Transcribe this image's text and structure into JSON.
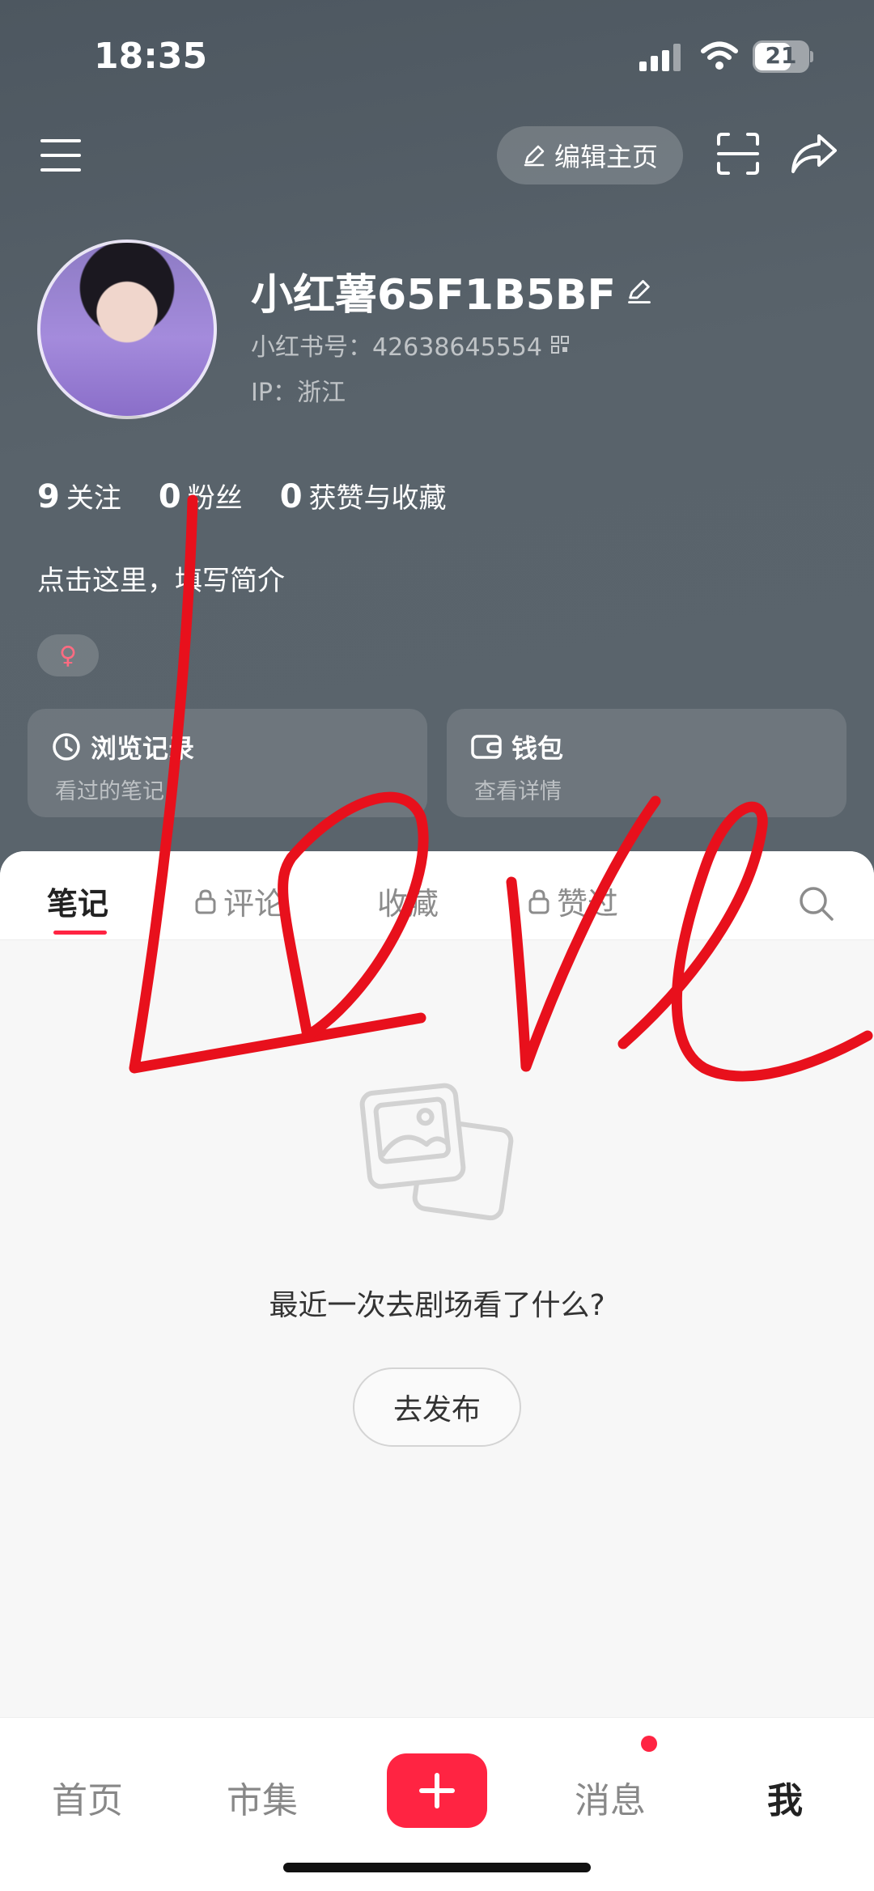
{
  "status_bar": {
    "time": "18:35",
    "battery": "21"
  },
  "header": {
    "edit_profile_label": "编辑主页"
  },
  "profile": {
    "nickname": "小红薯65F1B5BF",
    "red_id": "小红书号：42638645554",
    "ip": "IP：浙江",
    "bio_placeholder": "点击这里，填写简介",
    "gender_symbol": "♀"
  },
  "stats": [
    {
      "value": "9",
      "label": "关注"
    },
    {
      "value": "0",
      "label": "粉丝"
    },
    {
      "value": "0",
      "label": "获赞与收藏"
    }
  ],
  "cards": [
    {
      "title": "浏览记录",
      "subtitle": "看过的笔记"
    },
    {
      "title": "钱包",
      "subtitle": "查看详情"
    }
  ],
  "tabs": [
    {
      "label": "笔记"
    },
    {
      "label": "评论"
    },
    {
      "label": "收藏"
    },
    {
      "label": "赞过"
    }
  ],
  "empty_state": {
    "message": "最近一次去剧场看了什么?",
    "button": "去发布"
  },
  "bottom_nav": [
    {
      "label": "首页"
    },
    {
      "label": "市集"
    },
    {
      "label": "消息"
    },
    {
      "label": "我"
    }
  ],
  "colors": {
    "accent": "#ff2442",
    "header_bg": "#56606a",
    "doodle": "#e8101c"
  },
  "icons": {
    "status": [
      "signal-icon",
      "wifi-icon",
      "battery-icon"
    ],
    "top_bar": [
      "menu-icon",
      "edit-pencil-icon",
      "scan-icon",
      "share-icon"
    ],
    "cards": [
      "clock-icon",
      "wallet-icon"
    ],
    "tabs": [
      "lock-icon",
      "search-icon"
    ]
  }
}
